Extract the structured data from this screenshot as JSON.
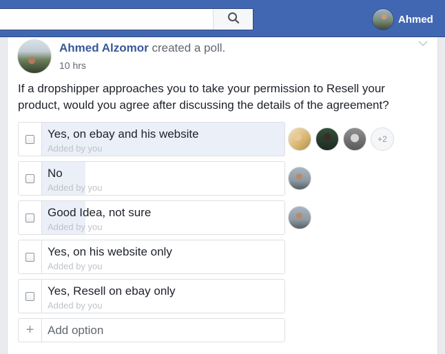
{
  "topbar": {
    "search_placeholder": "",
    "search_icon": "search-icon",
    "user_name": "Ahmed"
  },
  "post": {
    "author": "Ahmed Alzomor",
    "action": "created a poll.",
    "time": "10 hrs",
    "question": "If a dropshipper approaches you to take your permission to Resell your product, would you agree after discussing the details of the agreement?"
  },
  "poll": {
    "options": [
      {
        "label": "Yes, on ebay and his website",
        "added_by": "Added by you",
        "vote_share": 1.0,
        "voters": 3,
        "more_voters": "+2"
      },
      {
        "label": "No",
        "added_by": "Added by you",
        "vote_share": 0.18,
        "voters": 1
      },
      {
        "label": "Good Idea, not sure",
        "added_by": "Added by you",
        "vote_share": 0.18,
        "voters": 1
      },
      {
        "label": "Yes, on his website only",
        "added_by": "Added by you",
        "vote_share": 0,
        "voters": 0
      },
      {
        "label": "Yes, Resell on ebay only",
        "added_by": "Added by you",
        "vote_share": 0,
        "voters": 0
      }
    ],
    "add_option_placeholder": "Add option"
  },
  "colors": {
    "brand": "#4267b2",
    "link": "#385898",
    "bar_fill": "#ebeff7"
  }
}
